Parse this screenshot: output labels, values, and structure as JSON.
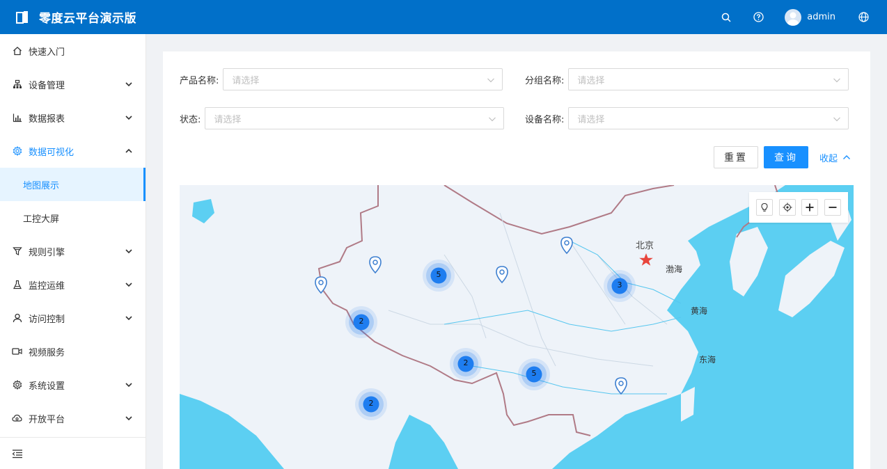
{
  "header": {
    "brand": "零度云平台演示版",
    "username": "admin"
  },
  "sidebar": {
    "items": [
      {
        "label": "快速入门",
        "icon": "home-icon"
      },
      {
        "label": "设备管理",
        "icon": "device-icon"
      },
      {
        "label": "数据报表",
        "icon": "bar-chart-icon"
      },
      {
        "label": "数据可视化",
        "icon": "gear-icon"
      },
      {
        "label": "规则引擎",
        "icon": "filter-icon"
      },
      {
        "label": "监控运维",
        "icon": "flask-icon"
      },
      {
        "label": "访问控制",
        "icon": "user-icon"
      },
      {
        "label": "视频服务",
        "icon": "video-icon"
      },
      {
        "label": "系统设置",
        "icon": "gear-icon"
      },
      {
        "label": "开放平台",
        "icon": "cloud-icon"
      }
    ],
    "sub": [
      {
        "label": "地图展示"
      },
      {
        "label": "工控大屏"
      }
    ]
  },
  "filters": {
    "product_label": "产品名称:",
    "group_label": "分组名称:",
    "status_label": "状态:",
    "device_label": "设备名称:",
    "placeholder": "请选择"
  },
  "actions": {
    "reset": "重置",
    "query": "查询",
    "collapse": "收起"
  },
  "map": {
    "labels": {
      "beijing": "北京",
      "bohai": "渤海",
      "yellow_sea": "黄海",
      "east_sea": "东海"
    },
    "clusters": [
      {
        "count": "5"
      },
      {
        "count": "3"
      },
      {
        "count": "2"
      },
      {
        "count": "2"
      },
      {
        "count": "5"
      },
      {
        "count": "2"
      }
    ],
    "colors": {
      "cluster": "#1e7df0",
      "water": "#5ccff2",
      "land": "#eef3f9",
      "border": "#b07a86"
    }
  }
}
